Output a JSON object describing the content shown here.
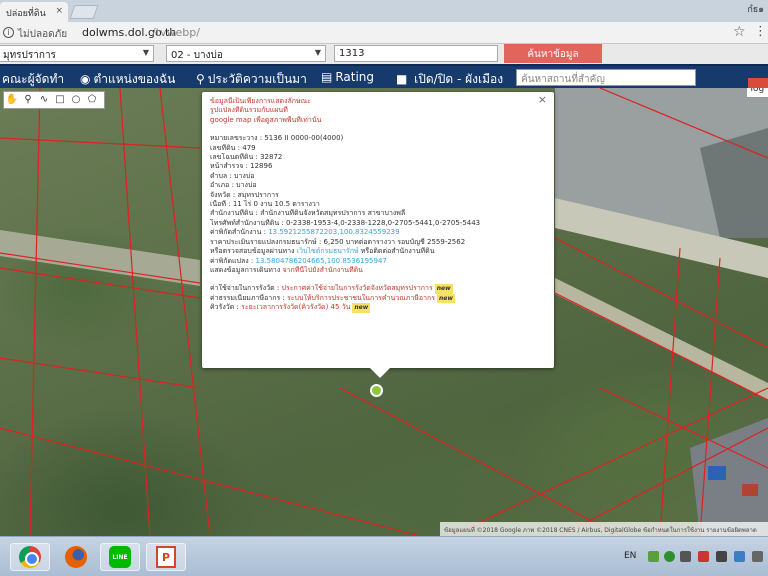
{
  "browser": {
    "tab_title": "ปล่อยที่ดิน",
    "tab_close": "×",
    "window_controls": "กํธ๑",
    "insecure_label": "ไม่ปลอดภัย",
    "url_host": "dolwms.dol.go.th",
    "url_path": "/tvwebp/",
    "icons": {
      "info": "info-icon",
      "star": "star-icon",
      "menu": "menu-icon"
    }
  },
  "search_form": {
    "province": "มุทรปราการ",
    "district": "02 - บางบ่อ",
    "parcel_no": "1313",
    "submit_label": "ค้นหาข้อมูล"
  },
  "navbar": {
    "items": [
      {
        "label": "คณะผู้จัดทำ",
        "icon": ""
      },
      {
        "label": "ตำแหน่งของฉัน",
        "icon": "location-icon"
      },
      {
        "label": "ประวัติความเป็นมา",
        "icon": "history-icon"
      },
      {
        "label": "Rating",
        "icon": "rating-icon"
      },
      {
        "label": "เปิด/ปิด - ผังเมือง",
        "icon": "square-icon"
      }
    ],
    "search_placeholder": "ค้นหาสถานที่สำคัญ"
  },
  "map": {
    "toggle_label": "Tog",
    "attribution": "ข้อมูลแผนที่ ©2018 Google ภาพ ©2018 CNES / Airbus, DigitalGlobe   ข้อกำหนดในการใช้งาน   รายงานข้อผิดพลาด",
    "tools": [
      "hand-icon",
      "marker-icon",
      "line-icon",
      "rectangle-icon",
      "circle-icon",
      "polygon-icon"
    ]
  },
  "popup": {
    "close": "×",
    "disclaimer": [
      "ข้อมูลนี้เป็นเพียงการแสดงลักษณะ",
      "รูปแปลงที่ดินรวมกับแผนที่"
    ],
    "google_map_label": "google map",
    "google_map_note": " เพื่อดูสภาพพื้นที่เท่านั้น",
    "fields": [
      {
        "label": "หมายเลขระวาง",
        "value": "5136 II 0000-00(4000)"
      },
      {
        "label": "เลขที่ดิน",
        "value": "479"
      },
      {
        "label": "เลขโฉนดที่ดิน",
        "value": "32872"
      },
      {
        "label": "หน้าสำรวจ",
        "value": "12896"
      },
      {
        "label": "ตำบล",
        "value": "บางบ่อ"
      },
      {
        "label": "อำเภอ",
        "value": "บางบ่อ"
      },
      {
        "label": "จังหวัด",
        "value": "สมุทรปราการ"
      },
      {
        "label": "เนื้อที่",
        "value": "11 ไร่ 0 งาน 10.5 ตารางวา"
      },
      {
        "label": "สำนักงานที่ดิน",
        "value": "สำนักงานที่ดินจังหวัดสมุทรปราการ สาขาบางพลี"
      },
      {
        "label": "โทรศัพท์สำนักงานที่ดิน",
        "value": "0-2338-1953-4,0-2338-1228,0-2705-5441,0-2705-5443"
      }
    ],
    "office_coord_label": "ค่าพิกัดสำนักงาน",
    "office_coord": "13.5921255872203,100.8324559239",
    "price_label": "ราคาประเมินรายแปลงกรมธนารักษ์",
    "price_value": "6,250 บาทต่อตารางวา รอบบัญชี 2559-2562",
    "verify_prefix": "หรือตรวจสอบข้อมูลผ่านทาง",
    "verify_link": "เว็บไซต์กรมธนารักษ์",
    "verify_suffix": " หรือติดต่อสำนักงานที่ดิน",
    "parcel_coord_label": "ค่าพิกัดแปลง",
    "parcel_coord": "13.5804786204665,100.8536195947",
    "route_label": "แสดงข้อมูลการเดินทาง",
    "route_link": "จากที่นี่ไปยังสำนักงานที่ดิน",
    "fees": [
      {
        "label": "ค่าใช้จ่ายในการรังวัด",
        "value": "ประกาศค่าใช้จ่ายในการรังวัดจังหวัดสมุทรปราการ"
      },
      {
        "label": "ค่าธรรมเนียมภาษีอากร",
        "value": "ระบบให้บริการประชาชนในการคำนวณภาษีอากร"
      },
      {
        "label": "คิวรังวัด",
        "value": "ระยะเวลาการรังวัด(คิวรังวัด) 45 วัน"
      }
    ],
    "new_badge": "new"
  },
  "taskbar": {
    "apps": [
      {
        "name": "chrome-icon",
        "active": true
      },
      {
        "name": "firefox-icon",
        "active": false
      },
      {
        "name": "line-icon",
        "label": "LINE",
        "active": true
      },
      {
        "name": "powerpoint-icon",
        "label": "P",
        "active": true
      }
    ],
    "tray_lang": "EN"
  }
}
